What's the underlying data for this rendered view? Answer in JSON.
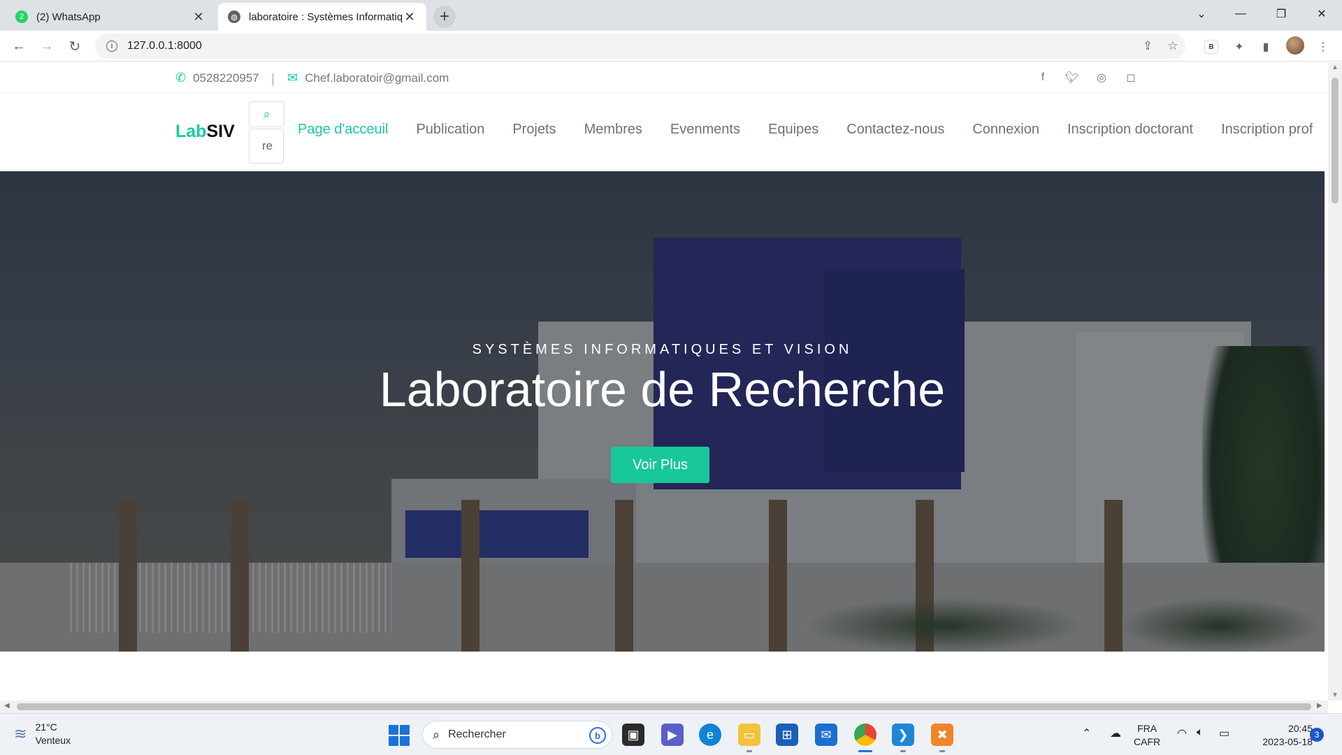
{
  "browser": {
    "tabs": [
      {
        "title": "(2) WhatsApp",
        "badge": "2",
        "active": false
      },
      {
        "title": "laboratoire : Systèmes Informatiq",
        "active": true
      }
    ],
    "address": "127.0.0.1:8000",
    "profile_badge": "B"
  },
  "page": {
    "topinfo": {
      "phone": "0528220957",
      "email": "Chef.laboratoir@gmail.com",
      "social": [
        "facebook-icon",
        "twitter-icon",
        "dribbble-icon",
        "instagram-icon"
      ]
    },
    "logo": {
      "part1": "Lab",
      "part2": "SIV"
    },
    "search": {
      "value": "re"
    },
    "menu": [
      {
        "label": "Page d'acceuil",
        "active": true
      },
      {
        "label": "Publication"
      },
      {
        "label": "Projets"
      },
      {
        "label": "Membres"
      },
      {
        "label": "Evenments"
      },
      {
        "label": "Equipes"
      },
      {
        "label": "Contactez-nous"
      },
      {
        "label": "Connexion"
      },
      {
        "label": "Inscription doctorant"
      },
      {
        "label": "Inscription prof"
      }
    ],
    "hero": {
      "subtitle": "SYSTÈMES INFORMATIQUES ET VISION",
      "title": "Laboratoire de Recherche",
      "button": "Voir Plus"
    }
  },
  "taskbar": {
    "weather": {
      "temp": "21°C",
      "desc": "Venteux"
    },
    "search_placeholder": "Rechercher",
    "lang": {
      "line1": "FRA",
      "line2": "CAFR"
    },
    "time": "20:45",
    "date": "2023-05-18",
    "notifications": "3"
  },
  "colors": {
    "accent": "#1bc8a0",
    "tab_bar": "#dee1e6",
    "taskbar": "#eef1f6"
  }
}
